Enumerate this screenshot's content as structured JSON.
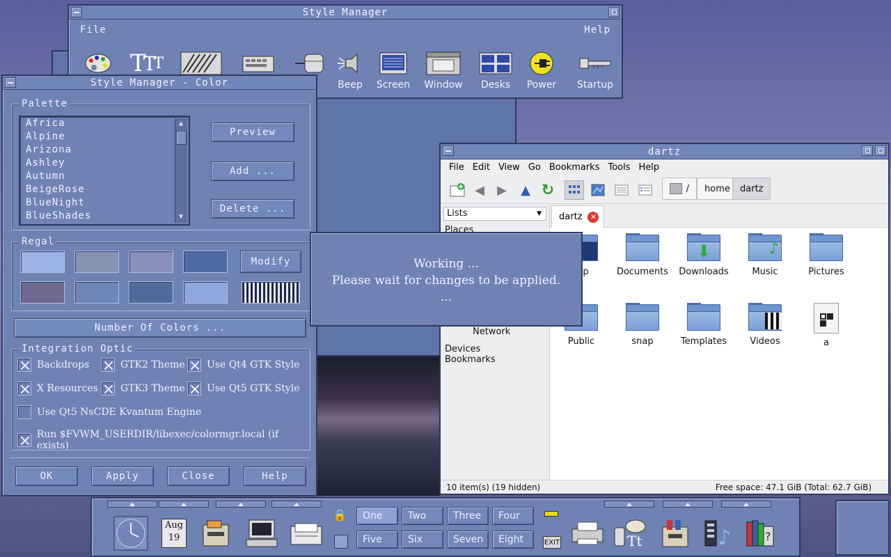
{
  "style_manager": {
    "title": "Style Manager",
    "menu_file": "File",
    "menu_help": "Help",
    "icons": [
      "Color",
      "Font",
      "Backdrop",
      "Keyboard",
      "Mouse",
      "Beep",
      "Screen",
      "Window",
      "Desks",
      "Power",
      "Startup"
    ]
  },
  "color_dialog": {
    "title": "Style Manager - Color",
    "palette_label": "Palette",
    "palettes": [
      "Africa",
      "Alpine",
      "Arizona",
      "Ashley",
      "Autumn",
      "BeigeRose",
      "BlueNight",
      "BlueShades"
    ],
    "preview": "Preview",
    "add": "Add ...",
    "delete": "Delete ...",
    "regal_label": "Regal",
    "modify": "Modify",
    "swatch_colors": [
      "#9cb2e6",
      "#8696b2",
      "#8790b8",
      "#4d6aa7",
      "#6e6a8e",
      "#6d87b9",
      "#516c9c",
      "#8fa6df"
    ],
    "number_of_colors": "Number Of Colors ...",
    "integration_label": "Integration Optic",
    "checks": {
      "backdrops": "Backdrops",
      "gtk2": "GTK2 Theme",
      "qt4": "Use Qt4 GTK Style",
      "xres": "X Resources",
      "gtk3": "GTK3 Theme",
      "qt5": "Use Qt5 GTK Style",
      "kvantum": "Use Qt5 NsCDE Kvantum Engine",
      "run": "Run $FVWM_USERDIR/libexec/colormgr.local (if exists)"
    },
    "ok": "OK",
    "apply": "Apply",
    "close": "Close",
    "help": "Help"
  },
  "working": {
    "line1": "Working ...",
    "line2": "Please wait for changes to be applied.",
    "line3": "..."
  },
  "file_manager": {
    "title": "dartz",
    "menu": [
      "File",
      "Edit",
      "View",
      "Go",
      "Bookmarks",
      "Tools",
      "Help"
    ],
    "crumbs": [
      "/",
      "home",
      "dartz"
    ],
    "side_dropdown": "Lists",
    "side_sections": [
      "Places",
      "Network",
      "Devices",
      "Bookmarks"
    ],
    "tab": "dartz",
    "files": [
      "top",
      "Documents",
      "Downloads",
      "Music",
      "Pictures",
      "Public",
      "snap",
      "Templates",
      "Videos",
      "a"
    ],
    "status_left": "10 item(s) (19 hidden)",
    "status_right": "Free space: 47.1 GiB (Total: 62.7 GiB)"
  },
  "panel": {
    "calendar_month": "Aug",
    "calendar_day": "19",
    "workspaces": [
      "One",
      "Two",
      "Three",
      "Four",
      "Five",
      "Six",
      "Seven",
      "Eight"
    ],
    "exit": "EXIT"
  }
}
